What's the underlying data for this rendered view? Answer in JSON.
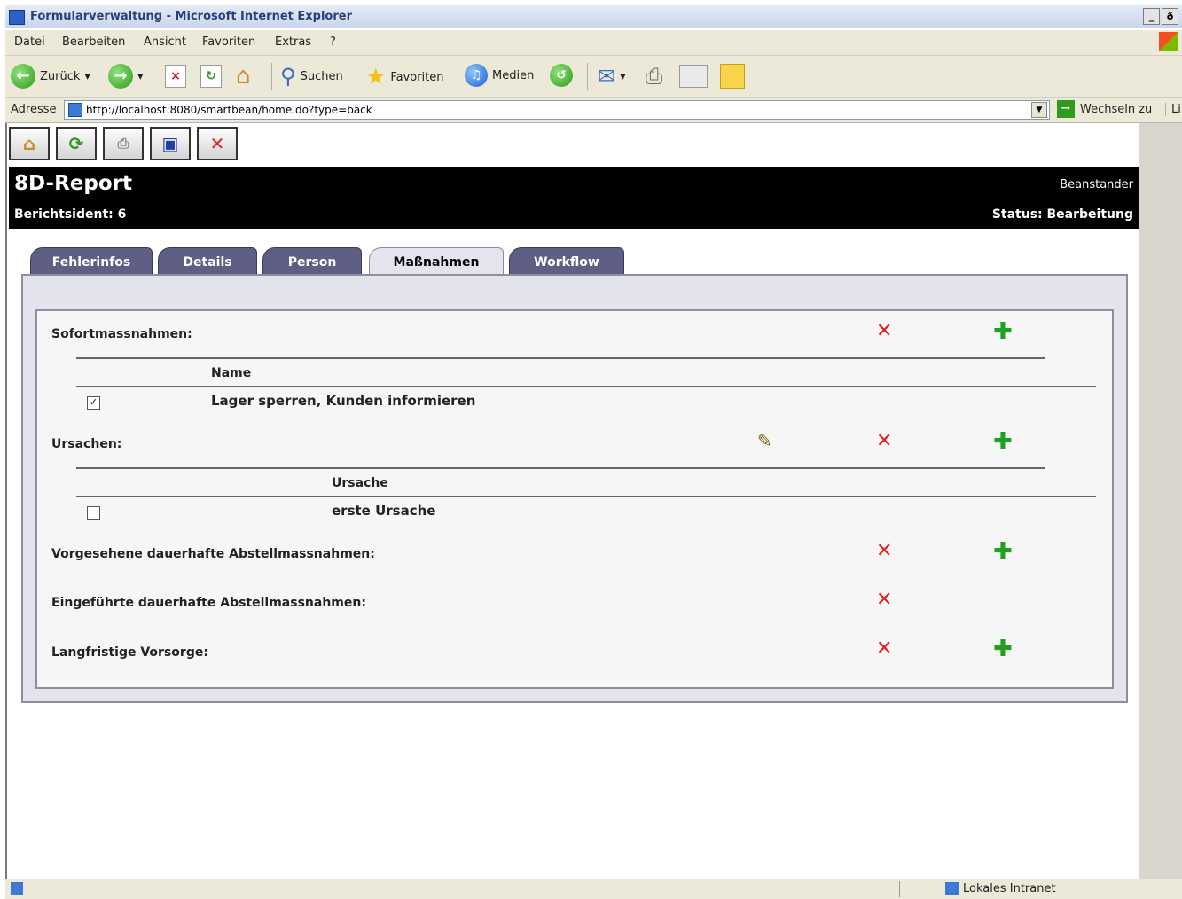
{
  "window": {
    "title": "Formularverwaltung - Microsoft Internet Explorer",
    "min": "_",
    "max": "ð",
    "close": "|"
  },
  "menu": [
    "Datei",
    "Bearbeiten",
    "Ansicht",
    "Favoriten",
    "Extras",
    "?"
  ],
  "toolbar": {
    "back": "Zurück",
    "search": "Suchen",
    "favorites": "Favoriten",
    "media": "Medien"
  },
  "address": {
    "label": "Adresse",
    "url": "http://localhost:8080/smartbean/home.do?type=back",
    "go": "Wechseln zu",
    "links": "Lin"
  },
  "header": {
    "title": "8D-Report",
    "subtitle": "Berichtsident: 6",
    "right_top": "Beanstander",
    "status": "Status: Bearbeitung"
  },
  "tabs": [
    {
      "label": "Fehlerinfos",
      "active": false
    },
    {
      "label": "Details",
      "active": false
    },
    {
      "label": "Person",
      "active": false
    },
    {
      "label": "Maßnahmen",
      "active": true
    },
    {
      "label": "Workflow",
      "active": false
    }
  ],
  "sections": {
    "sofort": {
      "label": "Sofortmassnahmen:",
      "column": "Name",
      "row": "Lager sperren, Kunden informieren",
      "checked": true
    },
    "ursachen": {
      "label": "Ursachen:",
      "column": "Ursache",
      "row": "erste Ursache",
      "checked": false
    },
    "vorgesehen": {
      "label": "Vorgesehene dauerhafte Abstellmassnahmen:"
    },
    "eingefuehrt": {
      "label": "Eingeführte dauerhafte Abstellmassnahmen:"
    },
    "vorsorge": {
      "label": "Langfristige Vorsorge:"
    }
  },
  "statusbar": {
    "zone": "Lokales Intranet"
  },
  "colors": {
    "header_bg": "#000000",
    "tab_inactive": "#5f5f86",
    "delete": "#e02020",
    "add": "#20a020"
  }
}
